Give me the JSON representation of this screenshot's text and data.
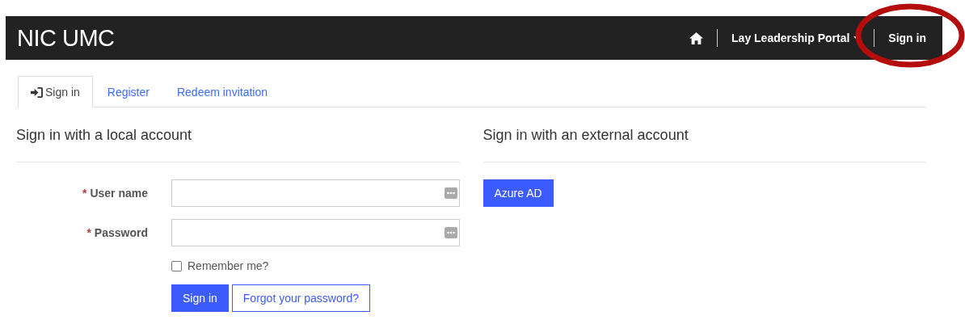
{
  "navbar": {
    "brand": "NIC UMC",
    "menu": {
      "label": "Lay Leadership Portal",
      "dropdown": true
    },
    "sign_in": "Sign in"
  },
  "annotation": {
    "kind": "ellipse"
  },
  "tabs": [
    {
      "label": "Sign in",
      "kind": "with-icon",
      "selected": true
    },
    {
      "label": "Register",
      "kind": "plain",
      "selected": false
    },
    {
      "label": "Redeem invitation",
      "kind": "plain",
      "selected": false
    }
  ],
  "local": {
    "heading": "Sign in with a local account",
    "fields": [
      {
        "required_mark": "*",
        "label": "User name"
      },
      {
        "required_mark": "*",
        "label": "Password"
      }
    ],
    "remember": {
      "label": "Remember me?",
      "checked": false
    },
    "buttons": [
      {
        "label": "Sign in",
        "kind": "primary"
      },
      {
        "label": "Forgot your password?",
        "kind": "outline"
      }
    ]
  },
  "external": {
    "heading": "Sign in with an external account",
    "providers": [
      "Azure AD"
    ]
  }
}
